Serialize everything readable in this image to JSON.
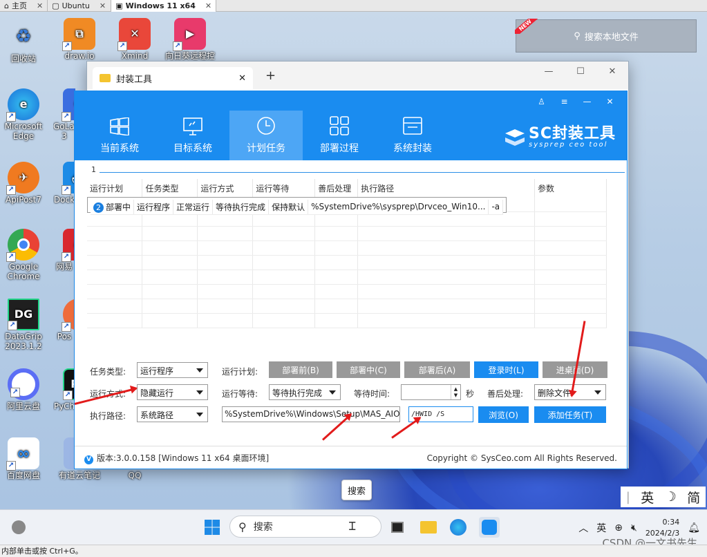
{
  "host_tabs": [
    {
      "label": "主页"
    },
    {
      "label": "Ubuntu"
    },
    {
      "label": "Windows 11 x64"
    }
  ],
  "desktop_icons": [
    {
      "label": "回收站",
      "color": "#d8e7f5"
    },
    {
      "label": "draw.io",
      "color": "#f08a24"
    },
    {
      "label": "Xmind",
      "color": "#e9473a"
    },
    {
      "label": "向日葵远程控",
      "color": "#e83a6b"
    },
    {
      "label": "Microsoft Edge",
      "color": "#1b8fd8"
    },
    {
      "label": "GoLand 3",
      "color": "#3b6ee0"
    },
    {
      "label": "ApiPost7",
      "color": "#f07a20"
    },
    {
      "label": "Dock",
      "color": "#1d8be6"
    },
    {
      "label": "Google Chrome",
      "color": "#e94235"
    },
    {
      "label": "网易",
      "color": "#d9272e"
    },
    {
      "label": "DataGrip 2023.1.2",
      "color": "#1f1f1f"
    },
    {
      "label": "Pos",
      "color": "#ef6c3b"
    },
    {
      "label": "阿里云盘",
      "color": "#5b6ef5"
    },
    {
      "label": "PyCh",
      "color": "#21d789"
    },
    {
      "label": "百度网盘",
      "color": "#2f8cf0"
    },
    {
      "label": "有道云笔记",
      "color": "#5a78f0"
    },
    {
      "label": "QQ",
      "color": "#1aa4f0"
    }
  ],
  "widget": {
    "search_label": "搜索本地文件",
    "badge": "NEW"
  },
  "explorer": {
    "tab_title": "封装工具",
    "new_tab": "+"
  },
  "app": {
    "nav": [
      {
        "label": "当前系统"
      },
      {
        "label": "目标系统"
      },
      {
        "label": "计划任务"
      },
      {
        "label": "部署过程"
      },
      {
        "label": "系统封装"
      }
    ],
    "logo_title": "SC封装工具",
    "logo_sub": "sysprep ceo tool",
    "page_marker": "1",
    "table": {
      "headers": [
        "运行计划",
        "任务类型",
        "运行方式",
        "运行等待",
        "善后处理",
        "执行路径",
        "参数"
      ],
      "rows": [
        [
          "部署中",
          "运行程序",
          "正常运行",
          "等待执行完成",
          "保持默认",
          "%SystemDrive%\\sysprep\\Drvceo_Win10...",
          "-a"
        ]
      ],
      "row_index": "2"
    },
    "form": {
      "task_type_label": "任务类型:",
      "task_type_value": "运行程序",
      "run_plan_label": "运行计划:",
      "plan_buttons": [
        "部署前(B)",
        "部署中(C)",
        "部署后(A)",
        "登录时(L)",
        "进桌面(D)"
      ],
      "run_mode_label": "运行方式:",
      "run_mode_value": "隐藏运行",
      "run_wait_label": "运行等待:",
      "run_wait_value": "等待执行完成",
      "wait_time_label": "等待时间:",
      "wait_time_value": "",
      "wait_unit": "秒",
      "after_label": "善后处理:",
      "after_value": "删除文件",
      "exec_path_label": "执行路径:",
      "exec_path_type": "系统路径",
      "exec_path_value": "%SystemDrive%\\Windows\\Setup\\MAS_AIO_",
      "param_value": "/HWID /S",
      "browse_button": "浏览(O)",
      "add_button": "添加任务(T)"
    },
    "footer": {
      "version": "版本:3.0.0.158 [Windows 11 x64 桌面环境]",
      "copyright": "Copyright © SysCeo.com All Rights Reserved."
    }
  },
  "tooltip": "搜索",
  "ime": [
    "英",
    "☽",
    "简"
  ],
  "taskbar": {
    "search_placeholder": "搜索",
    "tray_lang": "英",
    "time": "0:34",
    "date": "2024/2/3"
  },
  "statusbar": "内部单击或按 Ctrl+G。",
  "watermark": "CSDN @一文书先生"
}
